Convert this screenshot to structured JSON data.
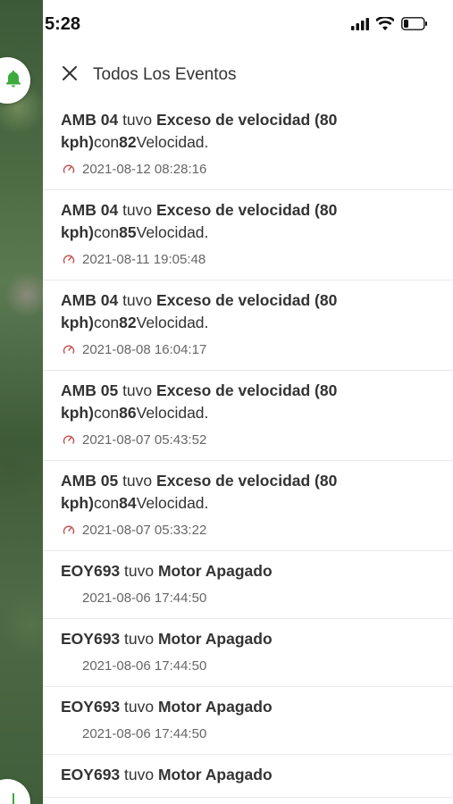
{
  "status_bar": {
    "time": "5:28"
  },
  "header": {
    "title": "Todos Los Eventos"
  },
  "colors": {
    "speed_icon": "#c45656",
    "map_fab_icon": "#3daa3d"
  },
  "events": [
    {
      "device": "AMB 04",
      "verb": "tuvo",
      "event": "Exceso de velocidad (80 kph)",
      "connector": "con",
      "value": "82",
      "suffix": "Velocidad.",
      "date": "2021-08-12 08:28:16",
      "icon": "speedometer-icon"
    },
    {
      "device": "AMB 04",
      "verb": "tuvo",
      "event": "Exceso de velocidad (80 kph)",
      "connector": "con",
      "value": "85",
      "suffix": "Velocidad.",
      "date": "2021-08-11 19:05:48",
      "icon": "speedometer-icon"
    },
    {
      "device": "AMB 04",
      "verb": "tuvo",
      "event": "Exceso de velocidad (80 kph)",
      "connector": "con",
      "value": "82",
      "suffix": "Velocidad.",
      "date": "2021-08-08 16:04:17",
      "icon": "speedometer-icon"
    },
    {
      "device": "AMB 05",
      "verb": "tuvo",
      "event": "Exceso de velocidad (80 kph)",
      "connector": "con",
      "value": "86",
      "suffix": "Velocidad.",
      "date": "2021-08-07 05:43:52",
      "icon": "speedometer-icon"
    },
    {
      "device": "AMB 05",
      "verb": "tuvo",
      "event": "Exceso de velocidad (80 kph)",
      "connector": "con",
      "value": "84",
      "suffix": "Velocidad.",
      "date": "2021-08-07 05:33:22",
      "icon": "speedometer-icon"
    },
    {
      "device": "EOY693",
      "verb": "tuvo",
      "event": "Motor Apagado",
      "connector": "",
      "value": "",
      "suffix": "",
      "date": "2021-08-06 17:44:50",
      "icon": ""
    },
    {
      "device": "EOY693",
      "verb": "tuvo",
      "event": "Motor Apagado",
      "connector": "",
      "value": "",
      "suffix": "",
      "date": "2021-08-06 17:44:50",
      "icon": ""
    },
    {
      "device": "EOY693",
      "verb": "tuvo",
      "event": "Motor Apagado",
      "connector": "",
      "value": "",
      "suffix": "",
      "date": "2021-08-06 17:44:50",
      "icon": ""
    },
    {
      "device": "EOY693",
      "verb": "tuvo",
      "event": "Motor Apagado",
      "connector": "",
      "value": "",
      "suffix": "",
      "date": "",
      "icon": ""
    }
  ]
}
